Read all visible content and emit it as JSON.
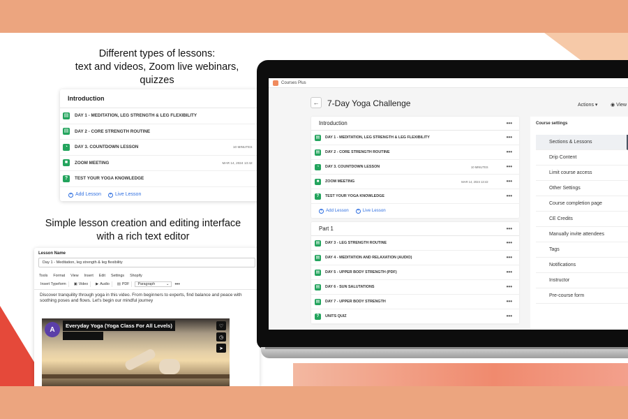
{
  "captions": {
    "top": [
      "Different types of lessons:",
      "text and videos, Zoom live webinars,",
      "quizzes"
    ],
    "middle": [
      "Simple lesson creation and editing interface",
      "with a rich text editor"
    ]
  },
  "left_card": {
    "title": "Introduction",
    "lessons": [
      {
        "label": "DAY 1 - MEDITATION, LEG STRENGTH & LEG FLEXIBILITY",
        "meta": "",
        "icon": "doc"
      },
      {
        "label": "DAY 2 - CORE STRENGTH ROUTINE",
        "meta": "",
        "icon": "doc"
      },
      {
        "label": "DAY 3. COUNTDOWN LESSON",
        "meta": "10 MINUTES",
        "icon": "timer"
      },
      {
        "label": "ZOOM MEETING",
        "meta": "MAR 14, 2024 13:42",
        "icon": "video"
      },
      {
        "label": "TEST YOUR YOGA KNOWLEDGE",
        "meta": "",
        "icon": "quiz"
      }
    ],
    "add_lesson": "Add Lesson",
    "live_lesson": "Live Lesson"
  },
  "editor": {
    "lesson_name_label": "Lesson Name",
    "lesson_name_value": "Day 1 - Meditation, leg strength & leg flexibility",
    "menus": [
      "Tools",
      "Format",
      "View",
      "Insert",
      "Edit",
      "Settings",
      "Shopify"
    ],
    "toolbar": {
      "typeform": "Insert Typeform",
      "video": "Video",
      "audio": "Audio",
      "pdf": "PDF",
      "paragraph": "Paragraph"
    },
    "body": "Discover tranquility through yoga in this video. From beginners to experts, find balance and peace with soothing poses and flows. Let's begin our mindful journey",
    "video_title": "Everyday Yoga (Yoga Class For All Levels)",
    "avatar_letter": "A"
  },
  "app": {
    "name": "Courses Plus",
    "course_title": "7-Day Yoga Challenge",
    "actions": "Actions",
    "view": "View",
    "sections": [
      {
        "title": "Introduction",
        "lessons": [
          {
            "label": "DAY 1 - MEDITATION, LEG STRENGTH & LEG FLEXIBILITY",
            "meta": "",
            "icon": "doc"
          },
          {
            "label": "DAY 2 - CORE STRENGTH ROUTINE",
            "meta": "",
            "icon": "doc"
          },
          {
            "label": "DAY 3. COUNTDOWN LESSON",
            "meta": "10 MINUTES",
            "icon": "timer"
          },
          {
            "label": "ZOOM MEETING",
            "meta": "MAR 14, 2024 13:42",
            "icon": "video"
          },
          {
            "label": "TEST YOUR YOGA KNOWLEDGE",
            "meta": "",
            "icon": "quiz"
          }
        ],
        "add_lesson": "Add Lesson",
        "live_lesson": "Live Lesson"
      },
      {
        "title": "Part 1",
        "lessons": [
          {
            "label": "DAY 3 - LEG STRENGTH ROUTINE",
            "meta": "",
            "icon": "doc"
          },
          {
            "label": "DAY 4 - MEDITATION AND RELAXATION (AUDIO)",
            "meta": "",
            "icon": "doc"
          },
          {
            "label": "DAY 5 - UPPER BODY STRENGTH (PDF)",
            "meta": "",
            "icon": "doc"
          },
          {
            "label": "DAY 6 - SUN SALUTATIONS",
            "meta": "",
            "icon": "doc"
          },
          {
            "label": "DAY 7 - UPPER BODY STRENGTH",
            "meta": "",
            "icon": "doc"
          },
          {
            "label": "UNITS QUIZ",
            "meta": "",
            "icon": "quiz"
          }
        ]
      }
    ],
    "settings": {
      "title": "Course settings",
      "items": [
        "Sections & Lessons",
        "Drip Content",
        "Limit course access",
        "Other Settings",
        "Course completion page",
        "CE Credits",
        "Manually invite attendees",
        "Tags",
        "Notifications",
        "Instructor",
        "Pre-course form"
      ],
      "active_index": 0
    }
  },
  "colors": {
    "accent_band": "#eca57f",
    "lesson_icon": "#23a45d",
    "link": "#2f6fe0",
    "avatar": "#5b3fa8"
  },
  "icons": {
    "doc": "document-icon",
    "timer": "timer-icon",
    "video": "video-icon",
    "quiz": "question-icon"
  }
}
